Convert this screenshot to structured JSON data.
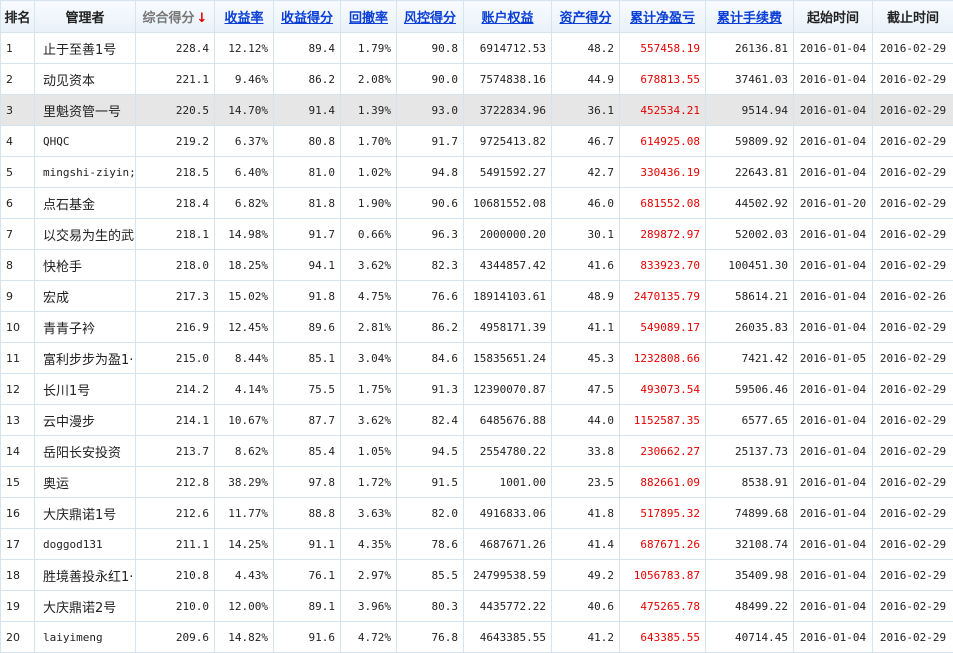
{
  "headers": [
    "排名",
    "管理者",
    "综合得分",
    "收益率",
    "收益得分",
    "回撤率",
    "风控得分",
    "账户权益",
    "资产得分",
    "累计净盈亏",
    "累计手续费",
    "起始时间",
    "截止时间"
  ],
  "sort_indicator": "↓",
  "colors": {
    "accent": "#0b3fd6",
    "negative": "#e60000",
    "grid": "#d6e4f0",
    "highlight": "#e6e6e6"
  },
  "rows": [
    [
      "1",
      "止于至善1号",
      "228.4",
      "12.12%",
      "89.4",
      "1.79%",
      "90.8",
      "6914712.53",
      "48.2",
      "557458.19",
      "26136.81",
      "2016-01-04",
      "2016-02-29"
    ],
    [
      "2",
      "动见资本",
      "221.1",
      "9.46%",
      "86.2",
      "2.08%",
      "90.0",
      "7574838.16",
      "44.9",
      "678813.55",
      "37461.03",
      "2016-01-04",
      "2016-02-29"
    ],
    [
      "3",
      "里魁资管一号",
      "220.5",
      "14.70%",
      "91.4",
      "1.39%",
      "93.0",
      "3722834.96",
      "36.1",
      "452534.21",
      "9514.94",
      "2016-01-04",
      "2016-02-29"
    ],
    [
      "4",
      "QHQC",
      "219.2",
      "6.37%",
      "80.8",
      "1.70%",
      "91.7",
      "9725413.82",
      "46.7",
      "614925.08",
      "59809.92",
      "2016-01-04",
      "2016-02-29"
    ],
    [
      "5",
      "mingshi-ziyin;",
      "218.5",
      "6.40%",
      "81.0",
      "1.02%",
      "94.8",
      "5491592.27",
      "42.7",
      "330436.19",
      "22643.81",
      "2016-01-04",
      "2016-02-29"
    ],
    [
      "6",
      "点石基金",
      "218.4",
      "6.82%",
      "81.8",
      "1.90%",
      "90.6",
      "10681552.08",
      "46.0",
      "681552.08",
      "44502.92",
      "2016-01-20",
      "2016-02-29"
    ],
    [
      "7",
      "以交易为生的武",
      "218.1",
      "14.98%",
      "91.7",
      "0.66%",
      "96.3",
      "2000000.20",
      "30.1",
      "289872.97",
      "52002.03",
      "2016-01-04",
      "2016-02-29"
    ],
    [
      "8",
      "快枪手",
      "218.0",
      "18.25%",
      "94.1",
      "3.62%",
      "82.3",
      "4344857.42",
      "41.6",
      "833923.70",
      "100451.30",
      "2016-01-04",
      "2016-02-29"
    ],
    [
      "9",
      "宏成",
      "217.3",
      "15.02%",
      "91.8",
      "4.75%",
      "76.6",
      "18914103.61",
      "48.9",
      "2470135.79",
      "58614.21",
      "2016-01-04",
      "2016-02-26"
    ],
    [
      "10",
      "青青子衿",
      "216.9",
      "12.45%",
      "89.6",
      "2.81%",
      "86.2",
      "4958171.39",
      "41.1",
      "549089.17",
      "26035.83",
      "2016-01-04",
      "2016-02-29"
    ],
    [
      "11",
      "富利步步为盈1·",
      "215.0",
      "8.44%",
      "85.1",
      "3.04%",
      "84.6",
      "15835651.24",
      "45.3",
      "1232808.66",
      "7421.42",
      "2016-01-05",
      "2016-02-29"
    ],
    [
      "12",
      "长川1号",
      "214.2",
      "4.14%",
      "75.5",
      "1.75%",
      "91.3",
      "12390070.87",
      "47.5",
      "493073.54",
      "59506.46",
      "2016-01-04",
      "2016-02-29"
    ],
    [
      "13",
      "云中漫步",
      "214.1",
      "10.67%",
      "87.7",
      "3.62%",
      "82.4",
      "6485676.88",
      "44.0",
      "1152587.35",
      "6577.65",
      "2016-01-04",
      "2016-02-29"
    ],
    [
      "14",
      "岳阳长安投资",
      "213.7",
      "8.62%",
      "85.4",
      "1.05%",
      "94.5",
      "2554780.22",
      "33.8",
      "230662.27",
      "25137.73",
      "2016-01-04",
      "2016-02-29"
    ],
    [
      "15",
      "奥运",
      "212.8",
      "38.29%",
      "97.8",
      "1.72%",
      "91.5",
      "1001.00",
      "23.5",
      "882661.09",
      "8538.91",
      "2016-01-04",
      "2016-02-29"
    ],
    [
      "16",
      "大庆鼎诺1号",
      "212.6",
      "11.77%",
      "88.8",
      "3.63%",
      "82.0",
      "4916833.06",
      "41.8",
      "517895.32",
      "74899.68",
      "2016-01-04",
      "2016-02-29"
    ],
    [
      "17",
      "doggod131",
      "211.1",
      "14.25%",
      "91.1",
      "4.35%",
      "78.6",
      "4687671.26",
      "41.4",
      "687671.26",
      "32108.74",
      "2016-01-04",
      "2016-02-29"
    ],
    [
      "18",
      "胜境善投永红1·",
      "210.8",
      "4.43%",
      "76.1",
      "2.97%",
      "85.5",
      "24799538.59",
      "49.2",
      "1056783.87",
      "35409.98",
      "2016-01-04",
      "2016-02-29"
    ],
    [
      "19",
      "大庆鼎诺2号",
      "210.0",
      "12.00%",
      "89.1",
      "3.96%",
      "80.3",
      "4435772.22",
      "40.6",
      "475265.78",
      "48499.22",
      "2016-01-04",
      "2016-02-29"
    ],
    [
      "20",
      "laiyimeng",
      "209.6",
      "14.82%",
      "91.6",
      "4.72%",
      "76.8",
      "4643385.55",
      "41.2",
      "643385.55",
      "40714.45",
      "2016-01-04",
      "2016-02-29"
    ]
  ]
}
